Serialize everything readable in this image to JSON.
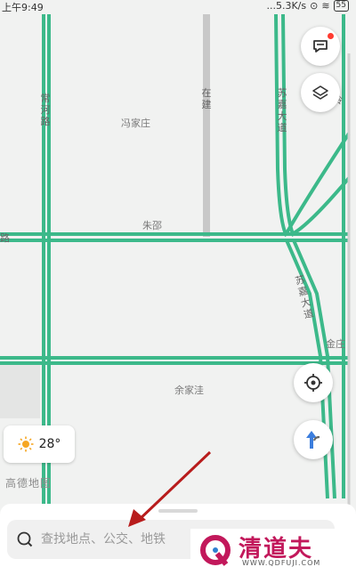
{
  "status_bar": {
    "time": "上午9:49",
    "speed": "...5.3K/s",
    "battery": "55"
  },
  "map": {
    "places": [
      "冯家庄",
      "朱邵",
      "余家洼",
      "金庄"
    ],
    "roads": {
      "left_vertical": "常河路",
      "center_vertical": "在建",
      "right_vertical": "苏嘉大道",
      "diagonal": "苏嘉大道",
      "horizontal_left": "路",
      "far_right": "岭"
    },
    "logo_text": "高德地图"
  },
  "weather": {
    "icon": "sun-icon",
    "temperature": "28°"
  },
  "search": {
    "placeholder": "查找地点、公交、地铁"
  },
  "watermark": {
    "text": "清道夫",
    "url": "WWW.QDFUJI.COM"
  },
  "colors": {
    "road": "#3cb98a",
    "annotation_arrow": "#b81c1c",
    "navigation_blue": "#3b7ddd",
    "notification_red": "#ff3b30",
    "weather_sun": "#f5a623"
  }
}
